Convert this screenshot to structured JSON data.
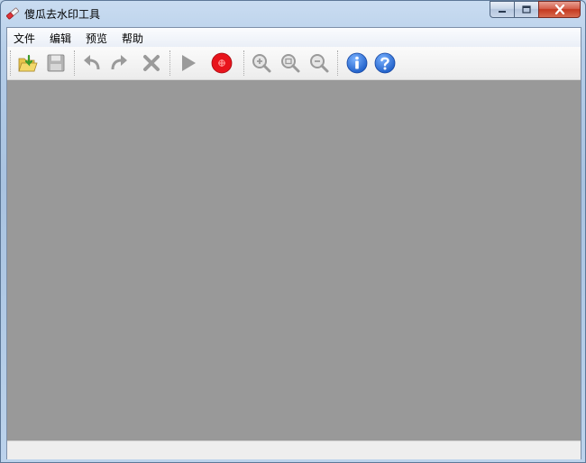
{
  "window": {
    "title": "傻瓜去水印工具",
    "icon": "eraser-icon",
    "captions": [
      "minimize-icon",
      "maximize-icon",
      "close-icon"
    ]
  },
  "menu": {
    "items": [
      {
        "label": "文件"
      },
      {
        "label": "编辑"
      },
      {
        "label": "预览"
      },
      {
        "label": "帮助"
      }
    ]
  },
  "toolbar": {
    "buttons": [
      {
        "icon": "open-folder-icon",
        "enabled": true
      },
      {
        "icon": "save-icon",
        "enabled": false
      },
      {
        "icon": "undo-icon",
        "enabled": false
      },
      {
        "icon": "redo-icon",
        "enabled": false
      },
      {
        "icon": "delete-icon",
        "enabled": false
      },
      {
        "icon": "play-icon",
        "enabled": false
      },
      {
        "icon": "record-stop-icon",
        "enabled": true
      },
      {
        "icon": "zoom-in-icon",
        "enabled": false
      },
      {
        "icon": "zoom-fit-icon",
        "enabled": false
      },
      {
        "icon": "zoom-out-icon",
        "enabled": false
      },
      {
        "icon": "info-icon",
        "enabled": true
      },
      {
        "icon": "help-icon",
        "enabled": true
      }
    ]
  },
  "colors": {
    "canvas": "#999999",
    "stop_button": "#e8141c",
    "info_blue": "#1f5fc8"
  }
}
